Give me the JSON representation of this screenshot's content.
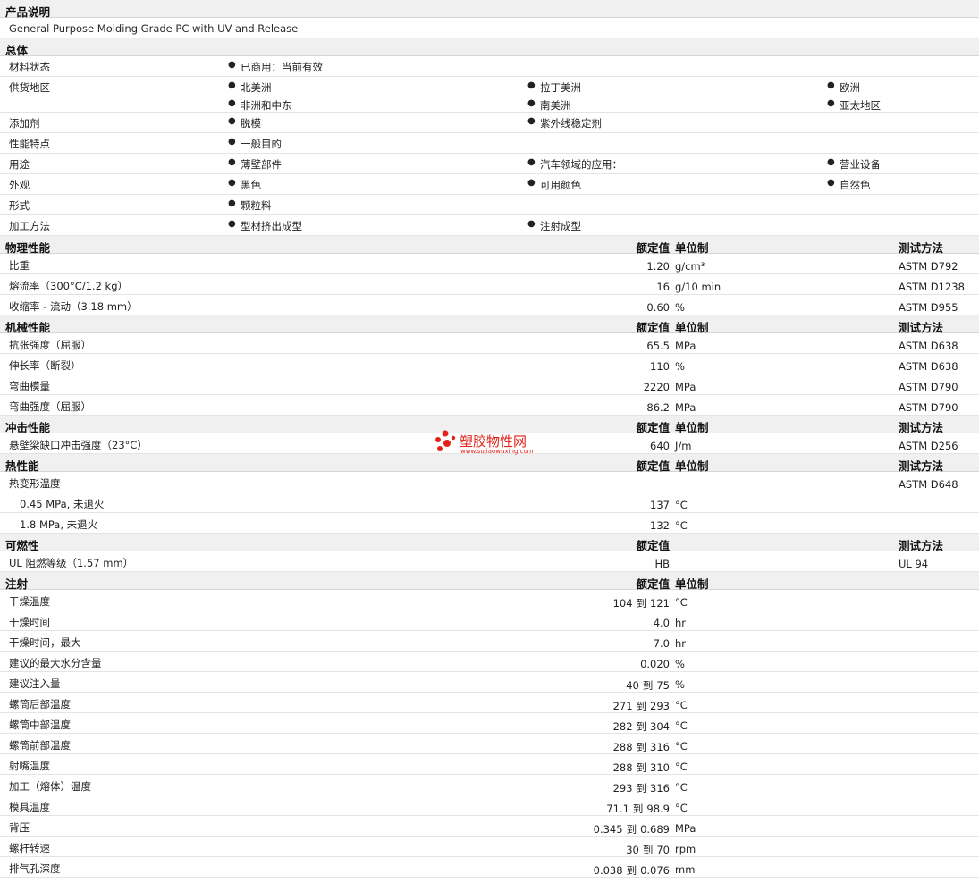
{
  "desc": {
    "header": "产品说明",
    "text": "General Purpose Molding Grade PC with UV and Release"
  },
  "general": {
    "header": "总体",
    "rows": {
      "status": {
        "label": "材料状态",
        "items": [
          "已商用：当前有效"
        ]
      },
      "region": {
        "label": "供货地区",
        "items": [
          "北美洲",
          "拉丁美洲",
          "欧洲",
          "非洲和中东",
          "南美洲",
          "亚太地区"
        ]
      },
      "additive": {
        "label": "添加剂",
        "items": [
          "脱模",
          "紫外线稳定剂"
        ]
      },
      "feature": {
        "label": "性能特点",
        "items": [
          "一般目的"
        ]
      },
      "use": {
        "label": "用途",
        "items": [
          "薄壁部件",
          "汽车领域的应用：",
          "营业设备"
        ]
      },
      "look": {
        "label": "外观",
        "items": [
          "黑色",
          "可用颜色",
          "自然色"
        ]
      },
      "form": {
        "label": "形式",
        "items": [
          "颗粒料"
        ]
      },
      "process": {
        "label": "加工方法",
        "items": [
          "型材挤出成型",
          "注射成型"
        ]
      }
    }
  },
  "headings": {
    "nominal": "额定值",
    "unit": "单位制",
    "method": "测试方法"
  },
  "sections": {
    "physical": {
      "title": "物理性能",
      "rows": [
        {
          "label": "比重",
          "value": "1.20",
          "unit": "g/cm³",
          "method": "ASTM D792"
        },
        {
          "label": "熔流率（300°C/1.2 kg）",
          "value": "16",
          "unit": "g/10 min",
          "method": "ASTM D1238"
        },
        {
          "label": "收缩率 - 流动（3.18 mm）",
          "value": "0.60",
          "unit": "%",
          "method": "ASTM D955"
        }
      ]
    },
    "mechanical": {
      "title": "机械性能",
      "rows": [
        {
          "label": "抗张强度（屈服）",
          "value": "65.5",
          "unit": "MPa",
          "method": "ASTM D638"
        },
        {
          "label": "伸长率（断裂）",
          "value": "110",
          "unit": "%",
          "method": "ASTM D638"
        },
        {
          "label": "弯曲模量",
          "value": "2220",
          "unit": "MPa",
          "method": "ASTM D790"
        },
        {
          "label": "弯曲强度（屈服）",
          "value": "86.2",
          "unit": "MPa",
          "method": "ASTM D790"
        }
      ]
    },
    "impact": {
      "title": "冲击性能",
      "rows": [
        {
          "label": "悬壁梁缺口冲击强度（23°C）",
          "value": "640",
          "unit": "J/m",
          "method": "ASTM D256"
        }
      ]
    },
    "thermal": {
      "title": "热性能",
      "rows": [
        {
          "label": "热变形温度",
          "value": "",
          "unit": "",
          "method": "ASTM D648"
        },
        {
          "label": "0.45 MPa, 未退火",
          "value": "137",
          "unit": "°C",
          "method": ""
        },
        {
          "label": "1.8 MPa, 未退火",
          "value": "132",
          "unit": "°C",
          "method": ""
        }
      ]
    },
    "flammability": {
      "title": "可燃性",
      "rows": [
        {
          "label": "UL 阻燃等级（1.57 mm）",
          "value": "HB",
          "unit": "",
          "method": "UL 94"
        }
      ]
    },
    "injection": {
      "title": "注射",
      "to": "到",
      "rows": [
        {
          "label": "干燥温度",
          "lo": "104",
          "hi": "121",
          "unit": "°C"
        },
        {
          "label": "干燥时间",
          "value": "4.0",
          "unit": "hr"
        },
        {
          "label": "干燥时间，最大",
          "value": "7.0",
          "unit": "hr"
        },
        {
          "label": "建议的最大水分含量",
          "value": "0.020",
          "unit": "%"
        },
        {
          "label": "建议注入量",
          "lo": "40",
          "hi": "75",
          "unit": "%"
        },
        {
          "label": "螺筒后部温度",
          "lo": "271",
          "hi": "293",
          "unit": "°C"
        },
        {
          "label": "螺筒中部温度",
          "lo": "282",
          "hi": "304",
          "unit": "°C"
        },
        {
          "label": "螺筒前部温度",
          "lo": "288",
          "hi": "316",
          "unit": "°C"
        },
        {
          "label": "射嘴温度",
          "lo": "288",
          "hi": "310",
          "unit": "°C"
        },
        {
          "label": "加工（熔体）温度",
          "lo": "293",
          "hi": "316",
          "unit": "°C"
        },
        {
          "label": "模具温度",
          "lo": "71.1",
          "hi": "98.9",
          "unit": "°C"
        },
        {
          "label": "背压",
          "lo": "0.345",
          "hi": "0.689",
          "unit": "MPa"
        },
        {
          "label": "螺杆转速",
          "lo": "30",
          "hi": "70",
          "unit": "rpm"
        },
        {
          "label": "排气孔深度",
          "lo": "0.038",
          "hi": "0.076",
          "unit": "mm"
        }
      ]
    }
  },
  "watermark": {
    "name": "塑胶物性网",
    "url": "www.sujiaowuxing.com",
    "color": "#e2231a"
  }
}
